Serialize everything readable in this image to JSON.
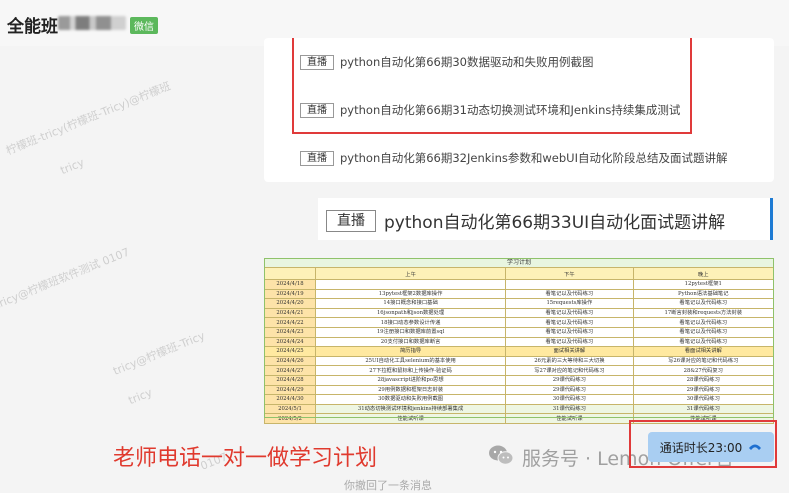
{
  "header": {
    "title": "全能班",
    "source_tag": "微信"
  },
  "watermarks": [
    "柠檬班-tricy(柠檬班-Tricy)@柠檬班",
    "tricy",
    "tricy@柠檬班软件测试 0107",
    "tricy@柠檬班-Tricy",
    "tricy",
    "0107"
  ],
  "lessons": [
    {
      "tag": "直播",
      "title": "python自动化第66期30数据驱动和失败用例截图"
    },
    {
      "tag": "直播",
      "title": "python自动化第66期31动态切换测试环境和Jenkins持续集成测试"
    },
    {
      "tag": "直播",
      "title": "python自动化第66期32Jenkins参数和webUI自动化阶段总结及面试题讲解"
    }
  ],
  "featured_lesson": {
    "tag": "直播",
    "title": "python自动化第66期33UI自动化面试题讲解"
  },
  "schedule": {
    "title": "学习计划",
    "headers": [
      "",
      "上午",
      "下午",
      "晚上"
    ],
    "rows": [
      [
        "2024/4/18",
        "",
        "",
        "12pytest框架1"
      ],
      [
        "2024/4/19",
        "13pytest框架2数据库操作",
        "看笔记以及代码练习",
        "Python语法基础笔记"
      ],
      [
        "2024/4/20",
        "14接口概念和接口基础",
        "15requests库操作",
        "看笔记以及代码练习"
      ],
      [
        "2024/4/21",
        "16jsonpath和json数据处理",
        "看笔记以及代码练习",
        "17断言封装和requests方法封装"
      ],
      [
        "2024/4/22",
        "18接口动态参数设计传递",
        "看笔记以及代码练习",
        "看笔记以及代码练习"
      ],
      [
        "2024/4/23",
        "19注册接口和数据库前置sql",
        "看笔记以及代码练习",
        "看笔记以及代码练习"
      ],
      [
        "2024/4/24",
        "20支付接口和数据库断言",
        "看笔记以及代码练习",
        "看笔记以及代码练习"
      ],
      [
        "2024/4/25",
        "简历指导",
        "面试相关讲解",
        "看面试相关讲解"
      ],
      [
        "2024/4/26",
        "25UI自动化工具selenium的基本使用",
        "26元素的三大等待和三大切换",
        "写26课对应的笔记和代码练习"
      ],
      [
        "2024/4/27",
        "27下拉框和鼠标和上传操作-验证码",
        "写27课对应的笔记和代码练习",
        "28&27代码复习"
      ],
      [
        "2024/4/28",
        "28javascript进阶和po思想",
        "29课代码练习",
        "28课代码练习"
      ],
      [
        "2024/4/29",
        "29用例数据和框架日志封装",
        "29课代码练习",
        "29课代码练习"
      ],
      [
        "2024/4/30",
        "30数据驱动和失败用例截图",
        "30课代码练习",
        "30课代码练习"
      ],
      [
        "2024/5/1",
        "31动态切换测试环境和jenkins持续部署集成",
        "31课代码练习",
        "31课代码练习"
      ],
      [
        "2024/5/2",
        "性能试听课",
        "性能试听课",
        "性能试听课"
      ]
    ]
  },
  "caption": "老师电话一对一做学习计划",
  "brand": {
    "label": "服务号 · Lemon Offer官"
  },
  "call": {
    "label": "通话时长23:00"
  },
  "footer_text": "你撤回了一条消息",
  "colors": {
    "accent_red": "#e03a2e",
    "bubble_blue": "#a9cef2",
    "wechat_green": "#5cb85c"
  }
}
